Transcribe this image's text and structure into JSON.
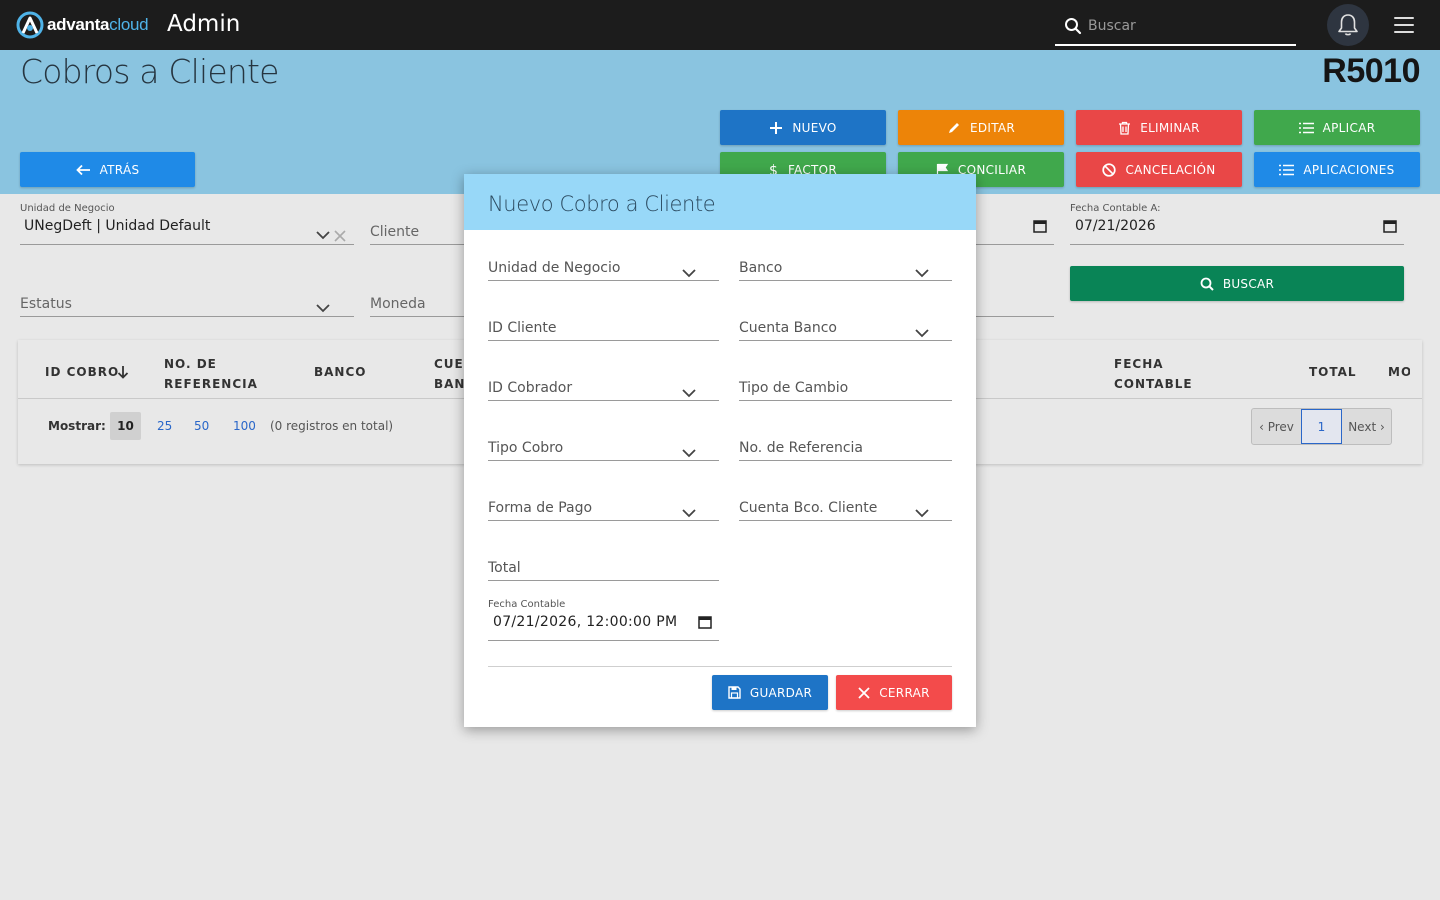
{
  "topbar": {
    "brand_left": "advanta",
    "brand_right": "cloud",
    "app_title": "Admin",
    "search_placeholder": "Buscar"
  },
  "header": {
    "page_title": "Cobros a Cliente",
    "report_code": "R5010"
  },
  "actions": {
    "nuevo": "NUEVO",
    "editar": "EDITAR",
    "eliminar": "ELIMINAR",
    "aplicar": "APLICAR",
    "atras": "ATRÁS",
    "factor": "FACTOR",
    "conciliar": "CONCILIAR",
    "cancelacion": "CANCELACIÓN",
    "aplicaciones": "APLICACIONES",
    "buscar": "BUSCAR"
  },
  "filters": {
    "unidad_label": "Unidad de Negocio",
    "unidad_value": "UNegDeft | Unidad Default",
    "cliente_placeholder": "Cliente",
    "estatus_placeholder": "Estatus",
    "moneda_placeholder": "Moneda",
    "fecha_a_label": "Fecha Contable A:",
    "fecha_a_value": "07/21/2026"
  },
  "table": {
    "columns": [
      {
        "line1": "ID COBRO",
        "line2": ""
      },
      {
        "line1": "NO. DE",
        "line2": "REFERENCIA"
      },
      {
        "line1": "BANCO",
        "line2": ""
      },
      {
        "line1": "CUENTA",
        "line2": "BANCO"
      },
      {
        "line1": "FECHA",
        "line2": "CONTABLE"
      },
      {
        "line1": "TOTAL",
        "line2": ""
      },
      {
        "line1": "MONEDA",
        "line2": ""
      }
    ],
    "show_label": "Mostrar:",
    "page_sizes": [
      "10",
      "25",
      "50",
      "100"
    ],
    "total_records": "(0 registros en total)",
    "prev": "‹ Prev",
    "current_page": "1",
    "next": "Next ›"
  },
  "modal": {
    "title": "Nuevo Cobro a Cliente",
    "fields": {
      "unidad": "Unidad de Negocio",
      "banco": "Banco",
      "id_cliente": "ID Cliente",
      "cuenta_banco": "Cuenta Banco",
      "id_cobrador": "ID Cobrador",
      "tipo_cambio": "Tipo de Cambio",
      "tipo_cobro": "Tipo Cobro",
      "no_referencia": "No. de Referencia",
      "forma_pago": "Forma de Pago",
      "cuenta_bco_cliente": "Cuenta Bco. Cliente",
      "total": "Total",
      "fecha_label": "Fecha Contable",
      "fecha_value": "07/21/2026, 12:00:00 PM"
    },
    "guardar": "GUARDAR",
    "cerrar": "CERRAR"
  }
}
